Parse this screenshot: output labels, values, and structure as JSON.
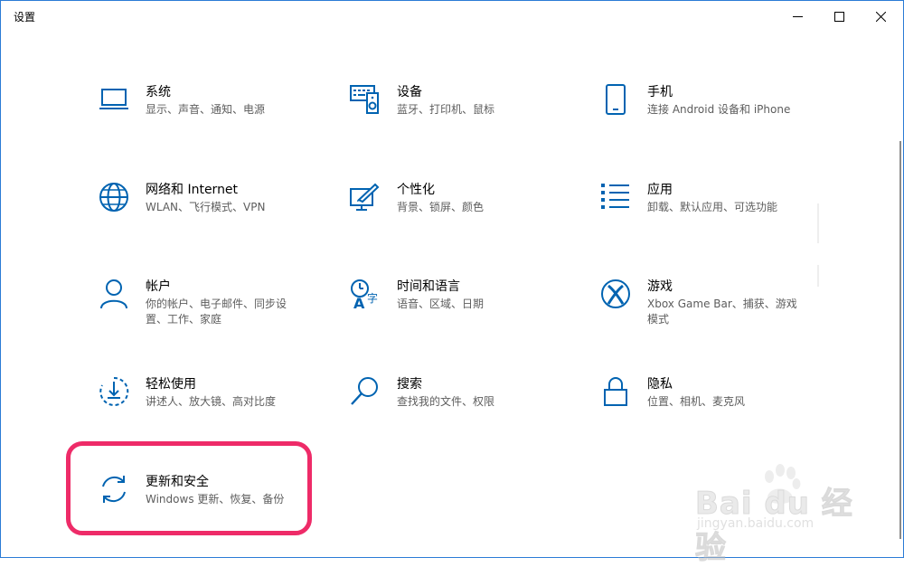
{
  "window": {
    "title": "设置",
    "controls": {
      "minimize_icon": "minimize-icon",
      "maximize_icon": "maximize-icon",
      "close_icon": "close-icon"
    }
  },
  "accent_color": "#0063b1",
  "highlight_color": "#ee2b68",
  "tiles": [
    {
      "name": "系统",
      "desc": "显示、声音、通知、电源",
      "icon": "laptop-icon"
    },
    {
      "name": "设备",
      "desc": "蓝牙、打印机、鼠标",
      "icon": "keyboard-speaker-icon"
    },
    {
      "name": "手机",
      "desc": "连接 Android 设备和 iPhone",
      "icon": "phone-icon"
    },
    {
      "name": "网络和 Internet",
      "desc": "WLAN、飞行模式、VPN",
      "icon": "globe-icon"
    },
    {
      "name": "个性化",
      "desc": "背景、锁屏、颜色",
      "icon": "paint-monitor-icon"
    },
    {
      "name": "应用",
      "desc": "卸载、默认应用、可选功能",
      "icon": "app-list-icon"
    },
    {
      "name": "帐户",
      "desc": "你的帐户、电子邮件、同步设置、工作、家庭",
      "icon": "person-icon"
    },
    {
      "name": "时间和语言",
      "desc": "语音、区域、日期",
      "icon": "time-language-icon"
    },
    {
      "name": "游戏",
      "desc": "Xbox Game Bar、捕获、游戏模式",
      "icon": "xbox-icon"
    },
    {
      "name": "轻松使用",
      "desc": "讲述人、放大镜、高对比度",
      "icon": "ease-of-access-icon"
    },
    {
      "name": "搜索",
      "desc": "查找我的文件、权限",
      "icon": "search-icon"
    },
    {
      "name": "隐私",
      "desc": "位置、相机、麦克风",
      "icon": "lock-icon"
    },
    {
      "name": "更新和安全",
      "desc": "Windows 更新、恢复、备份",
      "icon": "sync-icon"
    }
  ],
  "watermark": {
    "logo_text": "Bai du 经验",
    "url_text": "jingyan.baidu.com"
  }
}
